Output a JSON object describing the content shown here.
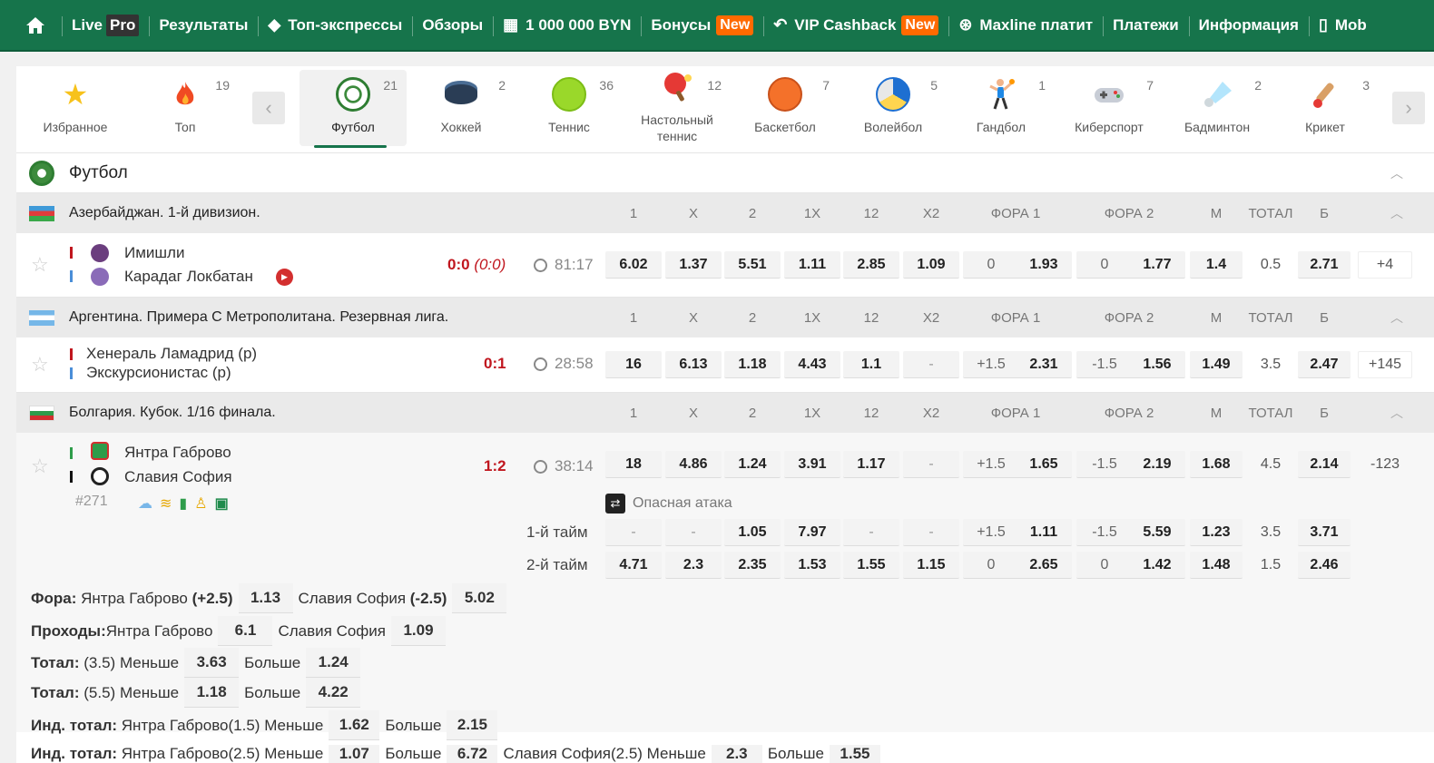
{
  "nav": {
    "live": "Live",
    "pro": "Pro",
    "results": "Результаты",
    "express": "Топ-экспрессы",
    "reviews": "Обзоры",
    "million": "1 000 000 BYN",
    "bonuses": "Бонусы",
    "new1": "New",
    "vip": "VIP Cashback",
    "new2": "New",
    "maxline": "Maxline платит",
    "payments": "Платежи",
    "info": "Информация",
    "mobile": "Mob"
  },
  "sports": [
    {
      "label": "Избранное",
      "count": ""
    },
    {
      "label": "Топ",
      "count": "19"
    },
    {
      "label": "Футбол",
      "count": "21"
    },
    {
      "label": "Хоккей",
      "count": "2"
    },
    {
      "label": "Теннис",
      "count": "36"
    },
    {
      "label": "Настольный теннис",
      "count": "12"
    },
    {
      "label": "Баскетбол",
      "count": "7"
    },
    {
      "label": "Волейбол",
      "count": "5"
    },
    {
      "label": "Гандбол",
      "count": "1"
    },
    {
      "label": "Киберспорт",
      "count": "7"
    },
    {
      "label": "Бадминтон",
      "count": "2"
    },
    {
      "label": "Крикет",
      "count": "3"
    }
  ],
  "section_title": "Футбол",
  "headers": {
    "c1": "1",
    "cx": "X",
    "c2": "2",
    "c1x": "1X",
    "c12": "12",
    "cx2": "X2",
    "f1": "ФОРА 1",
    "f2": "ФОРА 2",
    "m": "М",
    "total": "ТОТАЛ",
    "b": "Б"
  },
  "leagues": [
    {
      "name": "Азербайджан. 1-й дивизион.",
      "team1": "Имишли",
      "team2": "Карадаг Локбатан",
      "score": "0:0",
      "score_ht": "(0:0)",
      "time": "81:17",
      "odds": [
        "6.02",
        "1.37",
        "5.51",
        "1.11",
        "2.85",
        "1.09"
      ],
      "f1": [
        "0",
        "1.93"
      ],
      "f2": [
        "0",
        "1.77"
      ],
      "m": "1.4",
      "total": "0.5",
      "b": "2.71",
      "extra": "+4"
    },
    {
      "name": "Аргентина. Примера С Метрополитана. Резервная лига.",
      "team1": "Хенераль Ламадрид (р)",
      "team2": "Экскурсионистас (р)",
      "score": "0:1",
      "time": "28:58",
      "odds": [
        "16",
        "6.13",
        "1.18",
        "4.43",
        "1.1",
        "-"
      ],
      "f1": [
        "+1.5",
        "2.31"
      ],
      "f2": [
        "-1.5",
        "1.56"
      ],
      "m": "1.49",
      "total": "3.5",
      "b": "2.47",
      "extra": "+145"
    },
    {
      "name": "Болгария. Кубок. 1/16 финала.",
      "team1": "Янтра Габрово",
      "team2": "Славия София",
      "num": "#271",
      "score": "1:2",
      "time": "38:14",
      "odds": [
        "18",
        "4.86",
        "1.24",
        "3.91",
        "1.17",
        "-"
      ],
      "f1": [
        "+1.5",
        "1.65"
      ],
      "f2": [
        "-1.5",
        "2.19"
      ],
      "m": "1.68",
      "total": "4.5",
      "b": "2.14",
      "extra": "-123",
      "attack": "Опасная атака",
      "half1": {
        "label": "1-й тайм",
        "odds": [
          "-",
          "-",
          "1.05",
          "7.97",
          "-",
          "-"
        ],
        "f1": [
          "+1.5",
          "1.11"
        ],
        "f2": [
          "-1.5",
          "5.59"
        ],
        "m": "1.23",
        "total": "3.5",
        "b": "3.71"
      },
      "half2": {
        "label": "2-й тайм",
        "odds": [
          "4.71",
          "2.3",
          "2.35",
          "1.53",
          "1.55",
          "1.15"
        ],
        "f1": [
          "0",
          "2.65"
        ],
        "f2": [
          "0",
          "1.42"
        ],
        "m": "1.48",
        "total": "1.5",
        "b": "2.46"
      }
    }
  ],
  "markets": {
    "fora": {
      "label": "Фора:",
      "t1": "Янтра Габрово",
      "h1": "(+2.5)",
      "o1": "1.13",
      "t2": "Славия София",
      "h2": "(-2.5)",
      "o2": "5.02"
    },
    "pass": {
      "label": "Проходы:",
      "t1": "Янтра Габрово",
      "o1": "6.1",
      "t2": "Славия София",
      "o2": "1.09"
    },
    "tot1": {
      "label": "Тотал:",
      "line": "(3.5)",
      "less": "Меньше",
      "o1": "3.63",
      "more": "Больше",
      "o2": "1.24"
    },
    "tot2": {
      "label": "Тотал:",
      "line": "(5.5)",
      "less": "Меньше",
      "o1": "1.18",
      "more": "Больше",
      "o2": "4.22"
    },
    "ind1": {
      "label": "Инд. тотал:",
      "team": "Янтра Габрово(1.5)",
      "less": "Меньше",
      "o1": "1.62",
      "more": "Больше",
      "o2": "2.15"
    },
    "ind2": {
      "label": "Инд. тотал:",
      "team": "Янтра Габрово(2.5)",
      "less": "Меньше",
      "o1": "1.07",
      "more": "Больше",
      "o2": "6.72",
      "team2": "Славия София(2.5)",
      "less2": "Меньше",
      "o3": "2.3",
      "more2": "Больше",
      "o4": "1.55"
    }
  }
}
